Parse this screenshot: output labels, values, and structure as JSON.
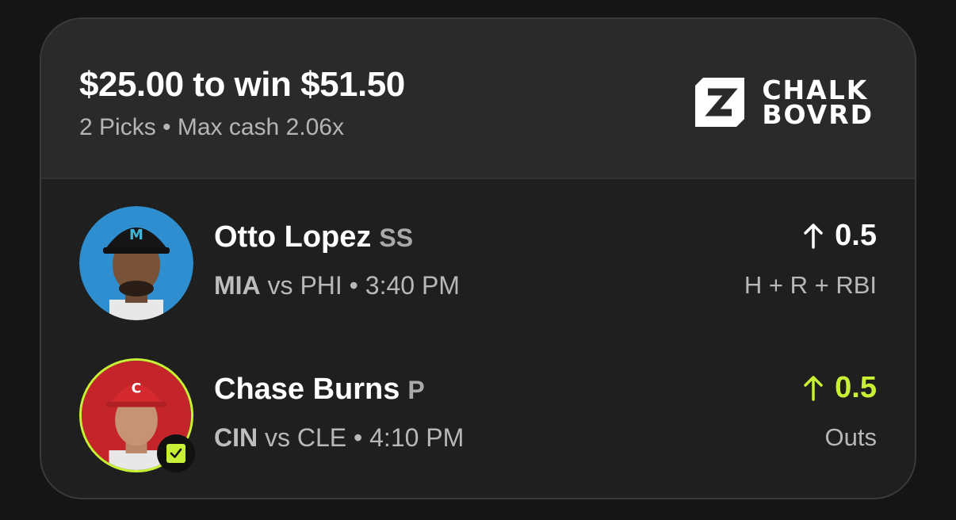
{
  "header": {
    "stake_text": "$25.00 to win $51.50",
    "subtitle": "2 Picks • Max cash 2.06x",
    "logo_line1": "CHALK",
    "logo_line2": "BOVRD"
  },
  "picks": [
    {
      "player": "Otto Lopez",
      "position": "SS",
      "team": "MIA",
      "matchup": "vs PHI • 3:40 PM",
      "direction_icon": "arrow-up-icon",
      "line": "0.5",
      "stat": "H + R + RBI",
      "status": "pending"
    },
    {
      "player": "Chase Burns",
      "position": "P",
      "team": "CIN",
      "matchup": "vs CLE • 4:10 PM",
      "direction_icon": "arrow-up-icon",
      "line": "0.5",
      "stat": "Outs",
      "status": "hit"
    }
  ],
  "colors": {
    "accent_green": "#c8f135",
    "card_bg": "#1f1f1f",
    "header_bg": "#2a2a2a"
  }
}
